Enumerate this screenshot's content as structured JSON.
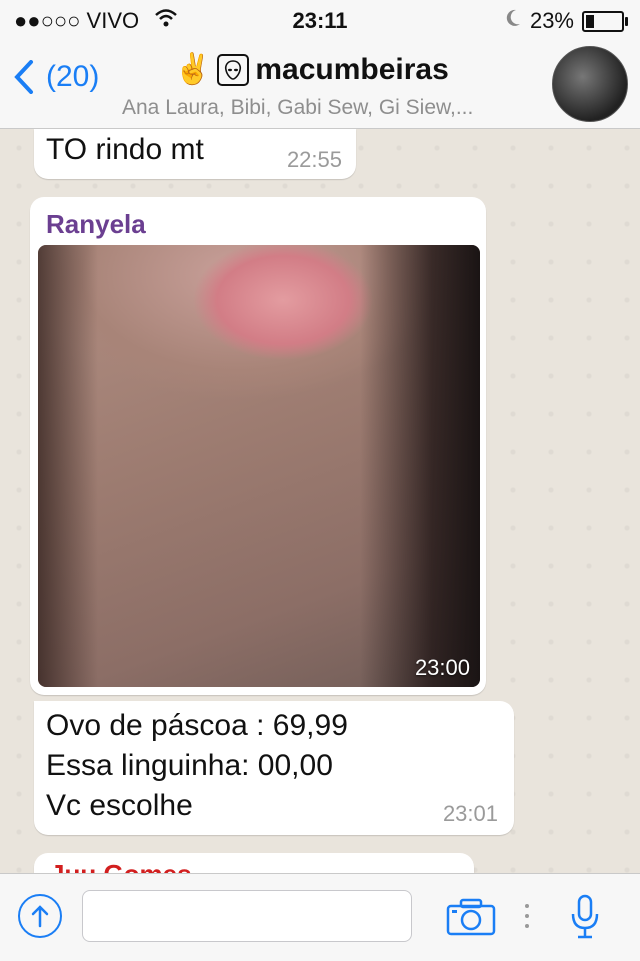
{
  "status_bar": {
    "carrier": "●●○○○ VIVO",
    "time": "23:11",
    "battery": "23%",
    "battery_level": 0.23
  },
  "header": {
    "back_count": "(20)",
    "emoji": "✌",
    "group_name": "macumbeiras",
    "members": "Ana Laura, Bibi, Gabi Sew, Gi Siew,..."
  },
  "messages": [
    {
      "type": "text",
      "text": "TO rindo mt",
      "time": "22:55"
    },
    {
      "type": "image",
      "sender": "Ranyela",
      "time": "23:00"
    },
    {
      "type": "text",
      "lines": [
        "Ovo de páscoa : 69,99",
        "Essa linguinha: 00,00",
        "Vc escolhe"
      ],
      "time": "23:01"
    },
    {
      "type": "partial",
      "sender": "Juu Gomes"
    }
  ],
  "input": {
    "placeholder": ""
  },
  "icons": {
    "back": "chevron-left-icon",
    "alien": "alien-icon",
    "send": "arrow-up-icon",
    "camera": "camera-icon",
    "mic": "microphone-icon",
    "wifi": "wifi-icon",
    "moon": "moon-icon"
  },
  "colors": {
    "accent": "#1a7ef5",
    "sender_purple": "#6b3f91",
    "sender_red": "#d21f1f"
  }
}
